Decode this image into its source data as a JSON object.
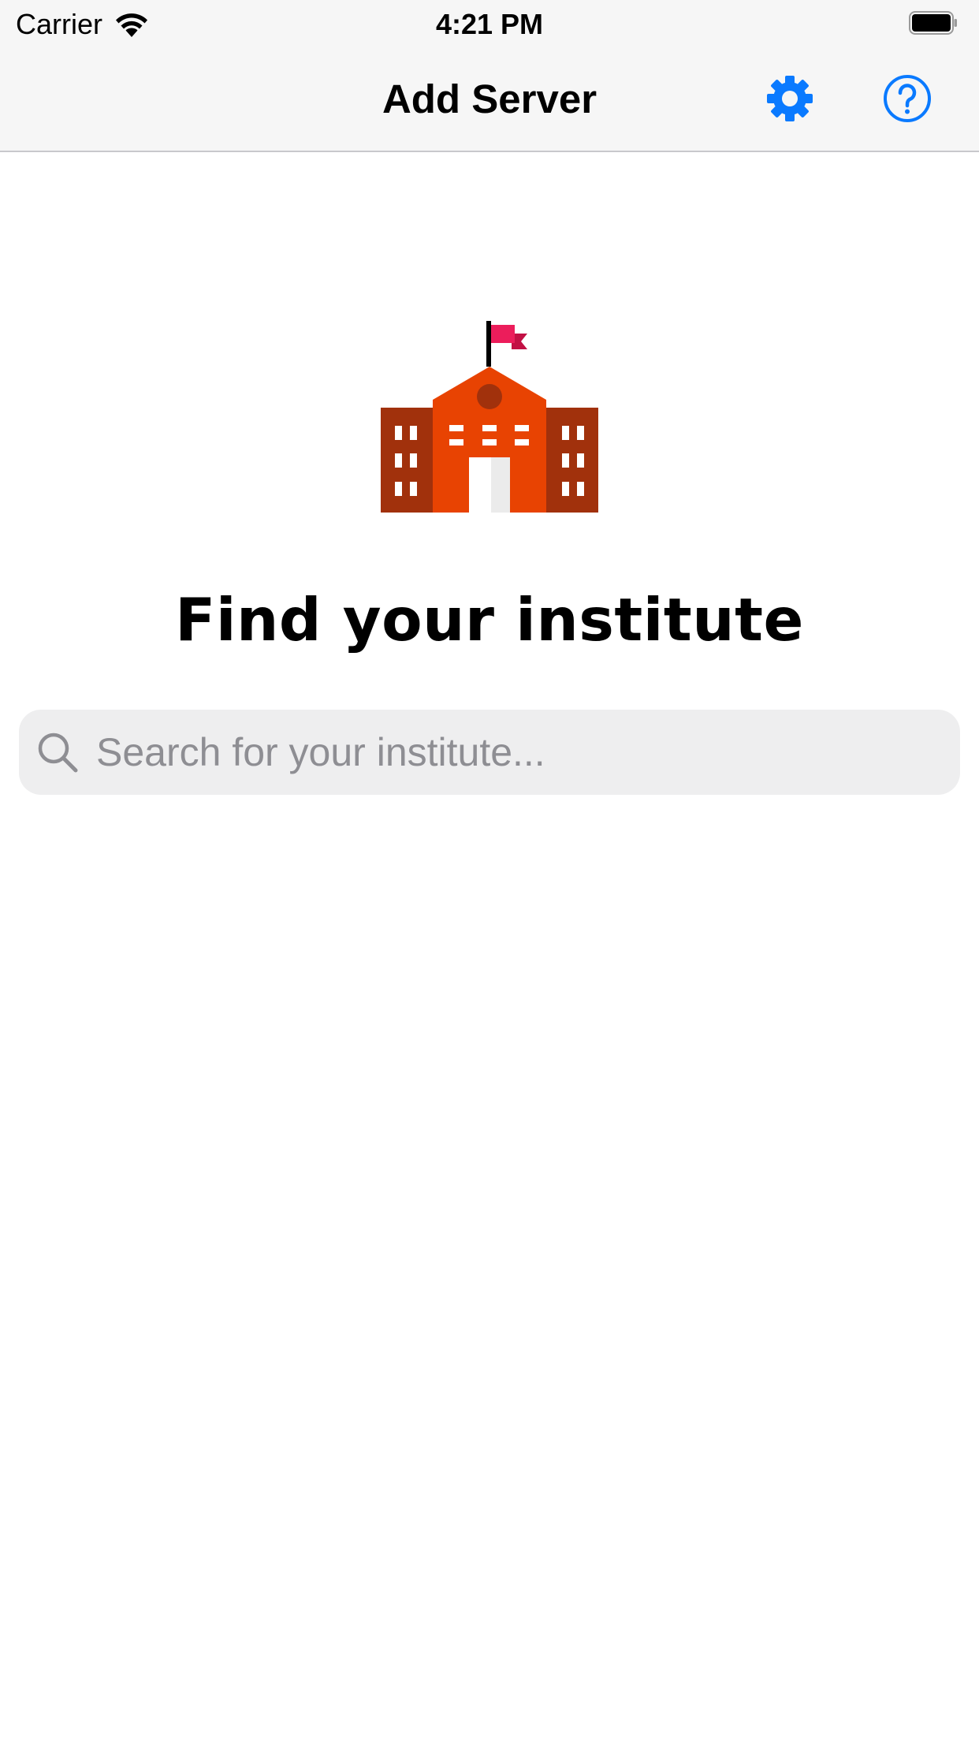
{
  "status_bar": {
    "carrier": "Carrier",
    "time": "4:21 PM",
    "wifi_icon": "wifi-icon",
    "battery_icon": "battery-full-icon"
  },
  "nav": {
    "title": "Add Server",
    "settings_icon": "gear-icon",
    "help_icon": "question-circle-icon",
    "accent": "#0a7aff"
  },
  "main": {
    "illustration_icon": "institute-building-icon",
    "heading": "Find your institute",
    "search": {
      "placeholder": "Search for your institute...",
      "value": ""
    }
  }
}
